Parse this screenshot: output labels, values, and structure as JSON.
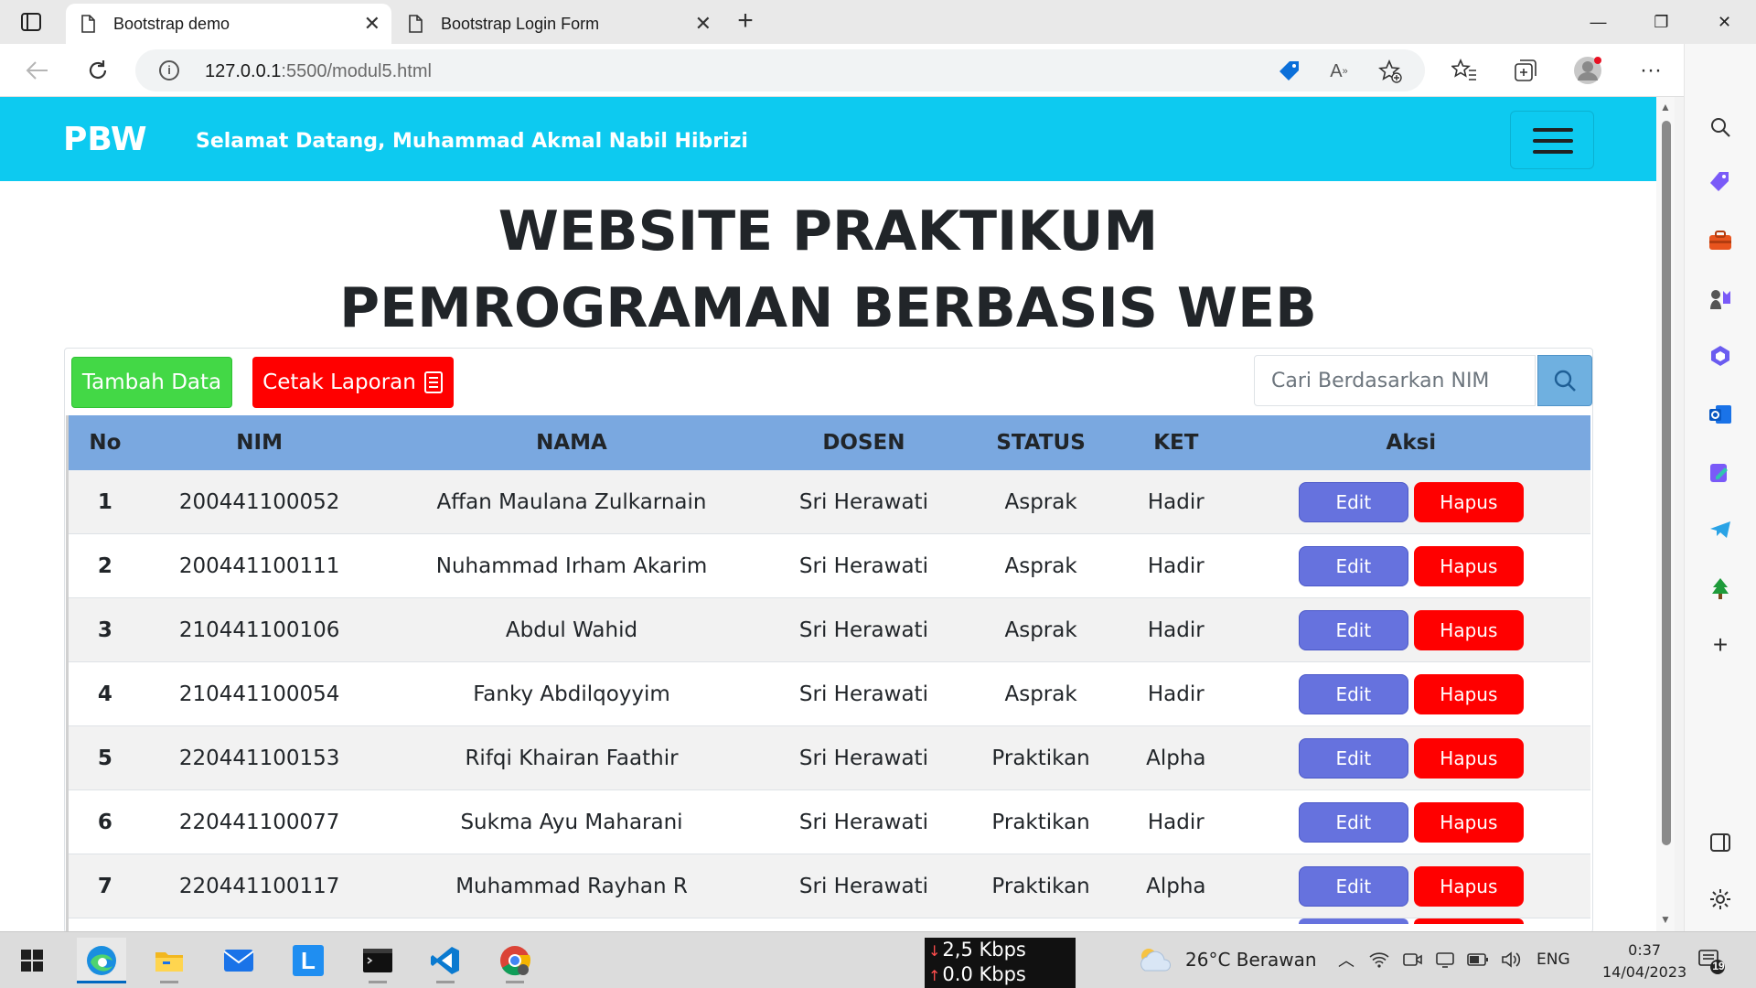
{
  "browser": {
    "tabs": [
      {
        "title": "Bootstrap demo",
        "active": true
      },
      {
        "title": "Bootstrap Login Form",
        "active": false
      }
    ],
    "address": {
      "host": "127.0.0.1",
      "path": ":5500/modul5.html"
    }
  },
  "navbar": {
    "brand": "PBW",
    "welcome": "Selamat Datang, Muhammad Akmal Nabil Hibrizi"
  },
  "page": {
    "title_line1": "WEBSITE PRAKTIKUM",
    "title_line2": "PEMROGRAMAN BERBASIS WEB",
    "add_button": "Tambah Data",
    "print_button": "Cetak Laporan",
    "search_placeholder": "Cari Berdasarkan NIM"
  },
  "table": {
    "headers": [
      "No",
      "NIM",
      "NAMA",
      "DOSEN",
      "STATUS",
      "KET",
      "Aksi"
    ],
    "edit_label": "Edit",
    "delete_label": "Hapus",
    "rows": [
      {
        "no": "1",
        "nim": "200441100052",
        "nama": "Affan Maulana Zulkarnain",
        "dosen": "Sri Herawati",
        "status": "Asprak",
        "ket": "Hadir"
      },
      {
        "no": "2",
        "nim": "200441100111",
        "nama": "Nuhammad Irham Akarim",
        "dosen": "Sri Herawati",
        "status": "Asprak",
        "ket": "Hadir"
      },
      {
        "no": "3",
        "nim": "210441100106",
        "nama": "Abdul Wahid",
        "dosen": "Sri Herawati",
        "status": "Asprak",
        "ket": "Hadir"
      },
      {
        "no": "4",
        "nim": "210441100054",
        "nama": "Fanky Abdilqoyyim",
        "dosen": "Sri Herawati",
        "status": "Asprak",
        "ket": "Hadir"
      },
      {
        "no": "5",
        "nim": "220441100153",
        "nama": "Rifqi Khairan Faathir",
        "dosen": "Sri Herawati",
        "status": "Praktikan",
        "ket": "Alpha"
      },
      {
        "no": "6",
        "nim": "220441100077",
        "nama": "Sukma Ayu Maharani",
        "dosen": "Sri Herawati",
        "status": "Praktikan",
        "ket": "Hadir"
      },
      {
        "no": "7",
        "nim": "220441100117",
        "nama": "Muhammad Rayhan R",
        "dosen": "Sri Herawati",
        "status": "Praktikan",
        "ket": "Alpha"
      }
    ]
  },
  "taskbar": {
    "net_down": "2,5 Kbps",
    "net_up": "0.0 Kbps",
    "weather": "26°C  Berawan",
    "lang": "ENG",
    "time": "0:37",
    "date": "14/04/2023",
    "notifications": "19"
  },
  "colors": {
    "navbar": "#0dcaf0",
    "table_header": "#7aa8e0",
    "add": "#43d846",
    "danger": "#ff0000",
    "edit": "#6672de"
  }
}
